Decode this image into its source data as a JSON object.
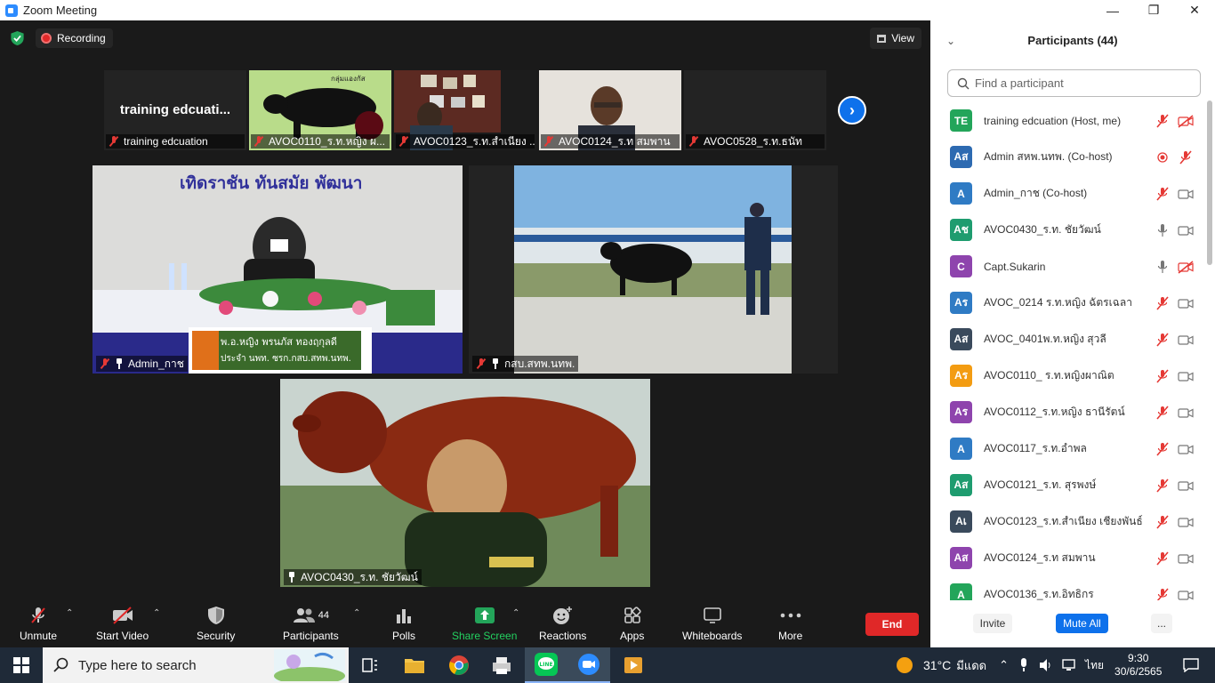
{
  "window": {
    "title": "Zoom Meeting",
    "minimize": "—",
    "restore": "❐",
    "close": "✕"
  },
  "topbar": {
    "recording_label": "Recording",
    "view_label": "View"
  },
  "thumbnails": [
    {
      "name": "training edcuation",
      "display": "training  edcuati..."
    },
    {
      "name": "AVOC0110_ร.ท.หญิง ผ..."
    },
    {
      "name": "AVOC0123_ร.ท.สำเนียง ..."
    },
    {
      "name": "AVOC0124_ร.ท สมพาน"
    },
    {
      "name": "AVOC0528_ร.ท.ธนัท"
    }
  ],
  "videos": {
    "left": {
      "name": "Admin_กาช",
      "banner_top": "เทิดราชัน   ทันสมัย   พัฒนา",
      "lower_third_1": "พ.อ.หญิง พรนภัส  ทองฤกุลดี",
      "lower_third_2": "ประจำ นพท. ซรก.กสบ.สทพ.นทพ.",
      "sign_thumb": "กลุ่มแองกัส"
    },
    "right": {
      "name": "กสบ.สทพ.นทพ."
    },
    "main": {
      "name": "AVOC0430_ร.ท. ชัยวัฒน์"
    }
  },
  "controls": {
    "unmute": "Unmute",
    "start_video": "Start Video",
    "security": "Security",
    "participants": "Participants",
    "participants_count": "44",
    "polls": "Polls",
    "share_screen": "Share Screen",
    "reactions": "Reactions",
    "apps": "Apps",
    "whiteboards": "Whiteboards",
    "more": "More",
    "end": "End"
  },
  "panel": {
    "title": "Participants (44)",
    "search_placeholder": "Find a participant",
    "participants": [
      {
        "initials": "TE",
        "color": "#23a55a",
        "name": "training edcuation (Host, me)",
        "mic": "muted",
        "video": "off"
      },
      {
        "initials": "Aส",
        "color": "#2d6ab1",
        "name": "Admin สหพ.นทพ. (Co-host)",
        "mic": "recording",
        "video": "off-mic"
      },
      {
        "initials": "A",
        "color": "#2f7bc4",
        "name": "Admin_กาช (Co-host)",
        "mic": "muted",
        "video": "on"
      },
      {
        "initials": "Aช",
        "color": "#1e9c6f",
        "name": "AVOC0430_ร.ท. ชัยวัฒน์",
        "mic": "on",
        "video": "on"
      },
      {
        "initials": "C",
        "color": "#8e44ad",
        "name": "Capt.Sukarin",
        "mic": "on",
        "video": "off"
      },
      {
        "initials": "Aร",
        "color": "#2f7bc4",
        "name": "AVOC_0214 ร.ท.หญิง ฉัตรเฉลา",
        "mic": "muted",
        "video": "on"
      },
      {
        "initials": "Aส",
        "color": "#3a4a5c",
        "name": "AVOC_0401พ.ท.หญิง สุวลี",
        "mic": "muted",
        "video": "on"
      },
      {
        "initials": "Aร",
        "color": "#f39c12",
        "name": "AVOC0110_ ร.ท.หญิงผาณิต",
        "mic": "muted",
        "video": "on"
      },
      {
        "initials": "Aร",
        "color": "#8e44ad",
        "name": "AVOC0112_ร.ท.หญิง ธานีรัตน์",
        "mic": "muted",
        "video": "on"
      },
      {
        "initials": "A",
        "color": "#2f7bc4",
        "name": "AVOC0117_ร.ท.อำพล",
        "mic": "muted",
        "video": "on"
      },
      {
        "initials": "Aส",
        "color": "#1e9c6f",
        "name": "AVOC0121_ร.ท. สุรพงษ์",
        "mic": "muted",
        "video": "on"
      },
      {
        "initials": "Aเ",
        "color": "#3a4a5c",
        "name": "AVOC0123_ร.ท.สำเนียง เชียงพันธ์",
        "mic": "muted",
        "video": "on"
      },
      {
        "initials": "Aส",
        "color": "#8e44ad",
        "name": "AVOC0124_ร.ท สมพาน",
        "mic": "muted",
        "video": "on"
      },
      {
        "initials": "A",
        "color": "#23a55a",
        "name": "AVOC0136_ร.ท.อิทธิกร",
        "mic": "muted",
        "video": "on"
      }
    ],
    "invite": "Invite",
    "mute_all": "Mute All",
    "more": "..."
  },
  "taskbar": {
    "search_placeholder": "Type here to search",
    "temperature": "31°C",
    "weather": "มีแดด",
    "language": "ไทย",
    "time": "9:30",
    "date": "30/6/2565"
  }
}
